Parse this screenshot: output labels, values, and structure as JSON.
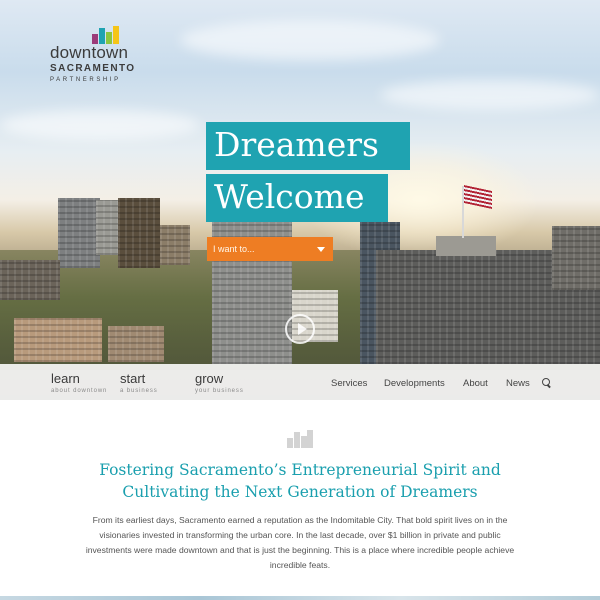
{
  "logo": {
    "wordmark": "downtown",
    "city": "SACRAMENTO",
    "tagline": "PARTNERSHIP",
    "bar_colors": [
      "#9b3b7a",
      "#1fa3b1",
      "#8cc63f",
      "#f5c518"
    ]
  },
  "hero": {
    "headline_line1": "Dreamers",
    "headline_line2": "Welcome",
    "accent_color": "#1fa3b1",
    "dropdown": {
      "selected": "I want to...",
      "color": "#ee7d23",
      "icon": "chevron-down-icon"
    },
    "play_icon": "play-circle-icon"
  },
  "nav": {
    "primary": [
      {
        "title": "learn",
        "subtitle": "about downtown"
      },
      {
        "title": "start",
        "subtitle": "a business"
      },
      {
        "title": "grow",
        "subtitle": "your business"
      }
    ],
    "links": [
      "Services",
      "Developments",
      "About",
      "News"
    ],
    "search_icon": "search-icon"
  },
  "content": {
    "icon": "bar-logo-icon",
    "title_line1": "Fostering Sacramento’s Entrepreneurial Spirit and",
    "title_line2": "Cultivating the Next Generation of Dreamers",
    "body": "From its earliest days, Sacramento earned a reputation as the Indomitable City. That bold spirit lives on in the visionaries invested in transforming the urban core. In the last decade, over $1 billion in private and public investments were made downtown and that is just the beginning. This is a place where incredible people achieve incredible feats."
  }
}
